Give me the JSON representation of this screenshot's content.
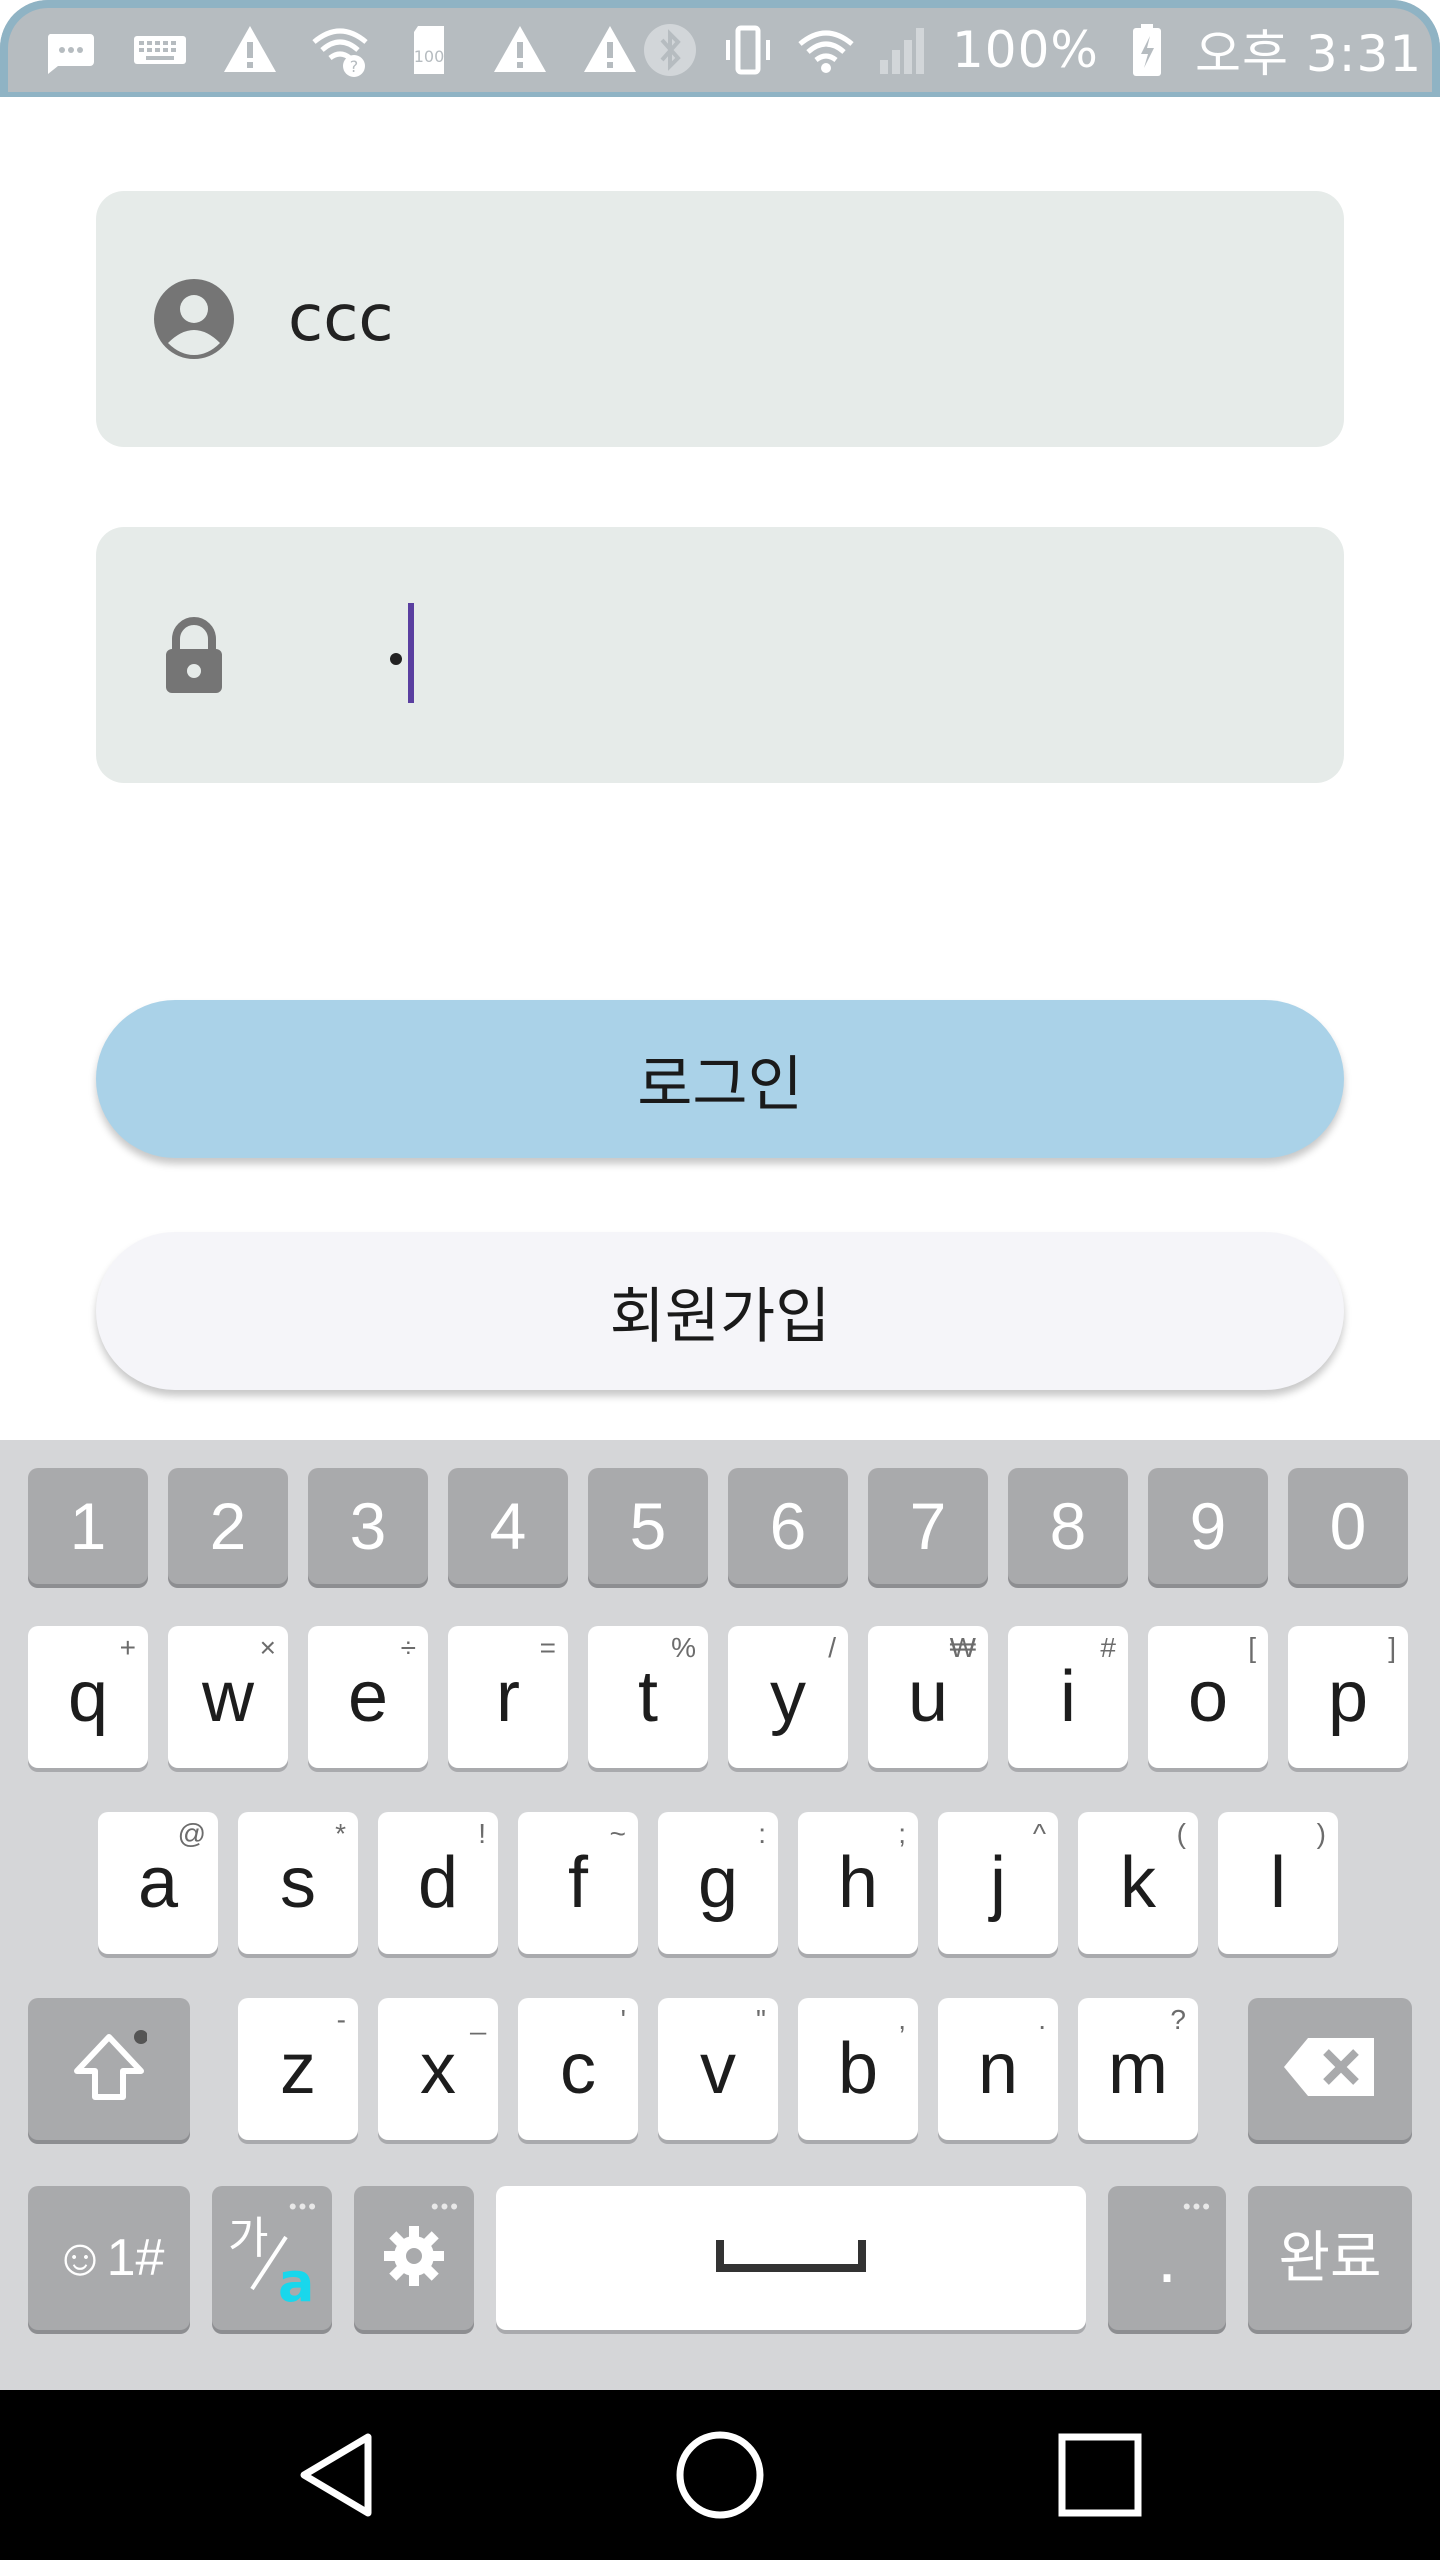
{
  "status_bar": {
    "battery_text": "100%",
    "time_text": "오후 3:31",
    "left_icons": [
      "more-notifications-icon",
      "keyboard-icon",
      "warning-icon",
      "wifi-question-icon",
      "sd-card-icon",
      "warning-icon",
      "warning-icon"
    ],
    "right_icons": [
      "bluetooth-icon",
      "vibrate-icon",
      "wifi-icon",
      "signal-icon",
      "battery-charging-icon"
    ]
  },
  "form": {
    "username": {
      "value": "ccc",
      "icon": "account-circle-icon"
    },
    "password": {
      "masked_value": "•",
      "icon": "lock-icon"
    },
    "login_button": "로그인",
    "signup_button": "회원가입",
    "colors": {
      "field_bg": "#e6ebe9",
      "login_bg": "#aad2e8",
      "signup_bg": "#f5f5f9",
      "caret": "#5a3fa0"
    }
  },
  "keyboard": {
    "number_row": [
      "1",
      "2",
      "3",
      "4",
      "5",
      "6",
      "7",
      "8",
      "9",
      "0"
    ],
    "row1": [
      {
        "k": "q",
        "s": "+"
      },
      {
        "k": "w",
        "s": "×"
      },
      {
        "k": "e",
        "s": "÷"
      },
      {
        "k": "r",
        "s": "="
      },
      {
        "k": "t",
        "s": "%"
      },
      {
        "k": "y",
        "s": "/"
      },
      {
        "k": "u",
        "s": "₩"
      },
      {
        "k": "i",
        "s": "#"
      },
      {
        "k": "o",
        "s": "["
      },
      {
        "k": "p",
        "s": "]"
      }
    ],
    "row2": [
      {
        "k": "a",
        "s": "@"
      },
      {
        "k": "s",
        "s": "*"
      },
      {
        "k": "d",
        "s": "!"
      },
      {
        "k": "f",
        "s": "~"
      },
      {
        "k": "g",
        "s": ":"
      },
      {
        "k": "h",
        "s": ";"
      },
      {
        "k": "j",
        "s": "^"
      },
      {
        "k": "k",
        "s": "("
      },
      {
        "k": "l",
        "s": ")"
      }
    ],
    "row3": [
      {
        "k": "z",
        "s": "-"
      },
      {
        "k": "x",
        "s": "_"
      },
      {
        "k": "c",
        "s": "'"
      },
      {
        "k": "v",
        "s": "\""
      },
      {
        "k": "b",
        "s": ","
      },
      {
        "k": "n",
        "s": "."
      },
      {
        "k": "m",
        "s": "?"
      }
    ],
    "symbol_key": "☺1#",
    "lang_key": "가/a",
    "period_key": ".",
    "done_key": "완료"
  },
  "nav_bar": {
    "buttons": [
      "back-icon",
      "home-icon",
      "recents-icon"
    ]
  }
}
